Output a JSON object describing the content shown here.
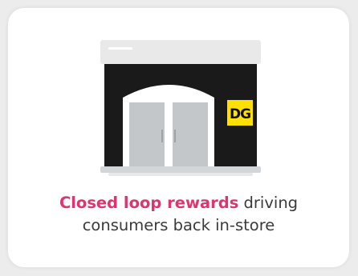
{
  "card": {
    "caption_highlight": "Closed loop rewards",
    "caption_rest_line1": " driving",
    "caption_line2": "consumers back in-store"
  },
  "store": {
    "logo_text": "DG",
    "colors": {
      "facade": "#1a1a1a",
      "sign_bar": "#e9e9e9",
      "door_glass": "#c4c7ca",
      "logo_bg": "#ffe000",
      "highlight": "#e0336f"
    }
  }
}
